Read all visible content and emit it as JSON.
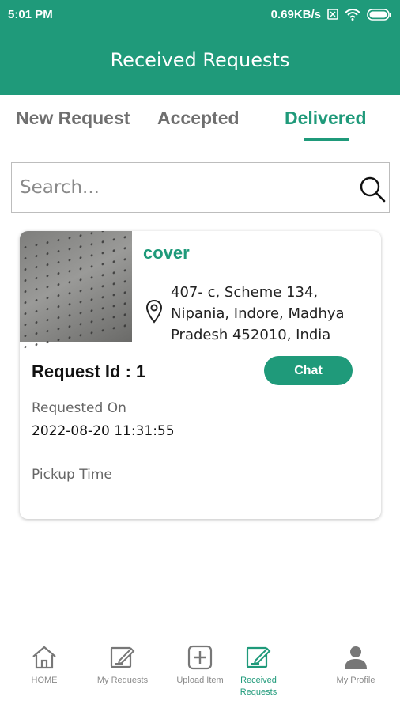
{
  "status_bar": {
    "time": "5:01 PM",
    "speed": "0.69KB/s"
  },
  "header": {
    "title": "Received Requests"
  },
  "tabs": [
    {
      "label": "New Request",
      "active": false
    },
    {
      "label": "Accepted",
      "active": false
    },
    {
      "label": "Delivered",
      "active": true
    }
  ],
  "search": {
    "placeholder": "Search...",
    "value": ""
  },
  "request_card": {
    "item_name": "cover",
    "address_lines": [
      "407- c, Scheme 134,",
      "Nipania, Indore, Madhya",
      "Pradesh 452010, India"
    ],
    "request_id_label": "Request Id : 1",
    "chat_label": "Chat",
    "requested_on_label": "Requested On",
    "requested_on_value": "2022-08-20 11:31:55",
    "pickup_time_label": "Pickup Time"
  },
  "bottom_nav": [
    {
      "label": "HOME",
      "icon": "home-icon",
      "active": false
    },
    {
      "label": "My Requests",
      "icon": "edit-icon",
      "active": false
    },
    {
      "label": "Upload Item",
      "icon": "plus-square-icon",
      "active": false
    },
    {
      "label": "Received Requests",
      "icon": "edit-icon",
      "active": true
    },
    {
      "label": "My Profile",
      "icon": "person-icon",
      "active": false
    }
  ],
  "colors": {
    "primary": "#1f9a7a",
    "inactive_tab": "#6f6f6f",
    "nav_inactive": "#8a8a8a"
  }
}
